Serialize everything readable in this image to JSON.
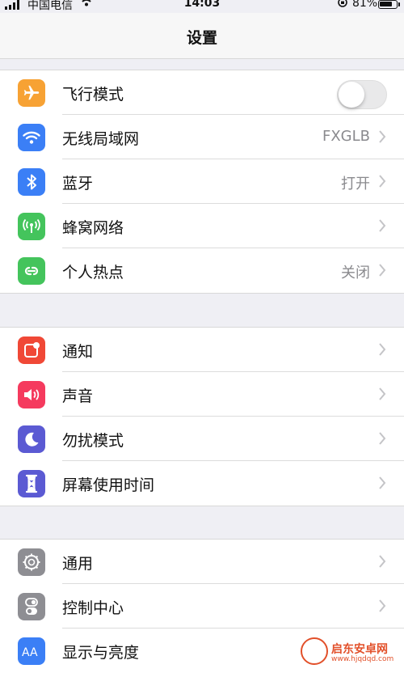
{
  "status_bar": {
    "carrier": "中国电信",
    "time": "14:03",
    "battery_pct": "81%",
    "battery_level": 0.81
  },
  "nav": {
    "title": "设置"
  },
  "groups": [
    {
      "rows": [
        {
          "label": "飞行模式",
          "icon": "airplane-icon",
          "color": "#f7a234",
          "control": "toggle",
          "toggle_on": false
        },
        {
          "label": "无线局域网",
          "icon": "wifi-icon",
          "color": "#3b7ff6",
          "value": "FXGLB"
        },
        {
          "label": "蓝牙",
          "icon": "bluetooth-icon",
          "color": "#3b7ff6",
          "value": "打开"
        },
        {
          "label": "蜂窝网络",
          "icon": "cellular-icon",
          "color": "#44c45c",
          "value": ""
        },
        {
          "label": "个人热点",
          "icon": "hotspot-icon",
          "color": "#44c45c",
          "value": "关闭"
        }
      ]
    },
    {
      "rows": [
        {
          "label": "通知",
          "icon": "notifications-icon",
          "color": "#f04836",
          "value": ""
        },
        {
          "label": "声音",
          "icon": "sound-icon",
          "color": "#f53a5e",
          "value": ""
        },
        {
          "label": "勿扰模式",
          "icon": "moon-icon",
          "color": "#5b5ad3",
          "value": ""
        },
        {
          "label": "屏幕使用时间",
          "icon": "hourglass-icon",
          "color": "#5b5ad3",
          "value": ""
        }
      ]
    },
    {
      "rows": [
        {
          "label": "通用",
          "icon": "gear-icon",
          "color": "#8e8e93",
          "value": ""
        },
        {
          "label": "控制中心",
          "icon": "switches-icon",
          "color": "#8e8e93",
          "value": ""
        },
        {
          "label": "显示与亮度",
          "icon": "display-icon",
          "color": "#3b7ff6",
          "value": ""
        }
      ]
    }
  ],
  "watermark": {
    "text": "启东安卓网",
    "url": "www.hjqdqd.com"
  }
}
